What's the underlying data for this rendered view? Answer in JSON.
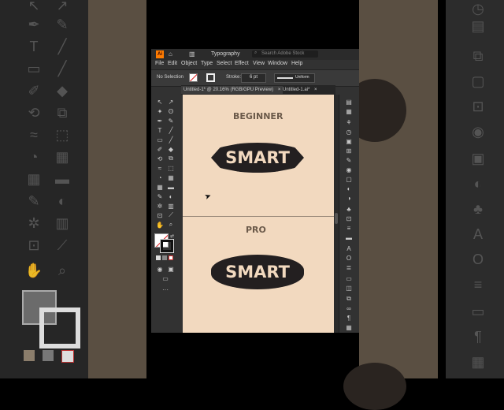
{
  "app": {
    "workspace": "Typography",
    "search_placeholder": "Search Adobe Stock",
    "menu": [
      "File",
      "Edit",
      "Object",
      "Type",
      "Select",
      "Effect",
      "View",
      "Window",
      "Help"
    ],
    "options": {
      "selection": "No Selection",
      "stroke_label": "Stroke:",
      "stroke_value": "6 pt",
      "profile": "Uniform"
    },
    "tabs": [
      {
        "label": "Untitled-1* @ 20.16% (RGB/GPU Preview)",
        "active": true
      },
      {
        "label": "Untitled-1.ai*",
        "active": false
      }
    ]
  },
  "artboards": [
    {
      "level": "BEGINNER",
      "badge_text": "SMART"
    },
    {
      "level": "PRO",
      "badge_text": "SMART"
    }
  ],
  "colors": {
    "canvas": "#f2d9bf",
    "badge": "#231f20",
    "label": "#6b5a4a",
    "ui_dark": "#323232"
  }
}
